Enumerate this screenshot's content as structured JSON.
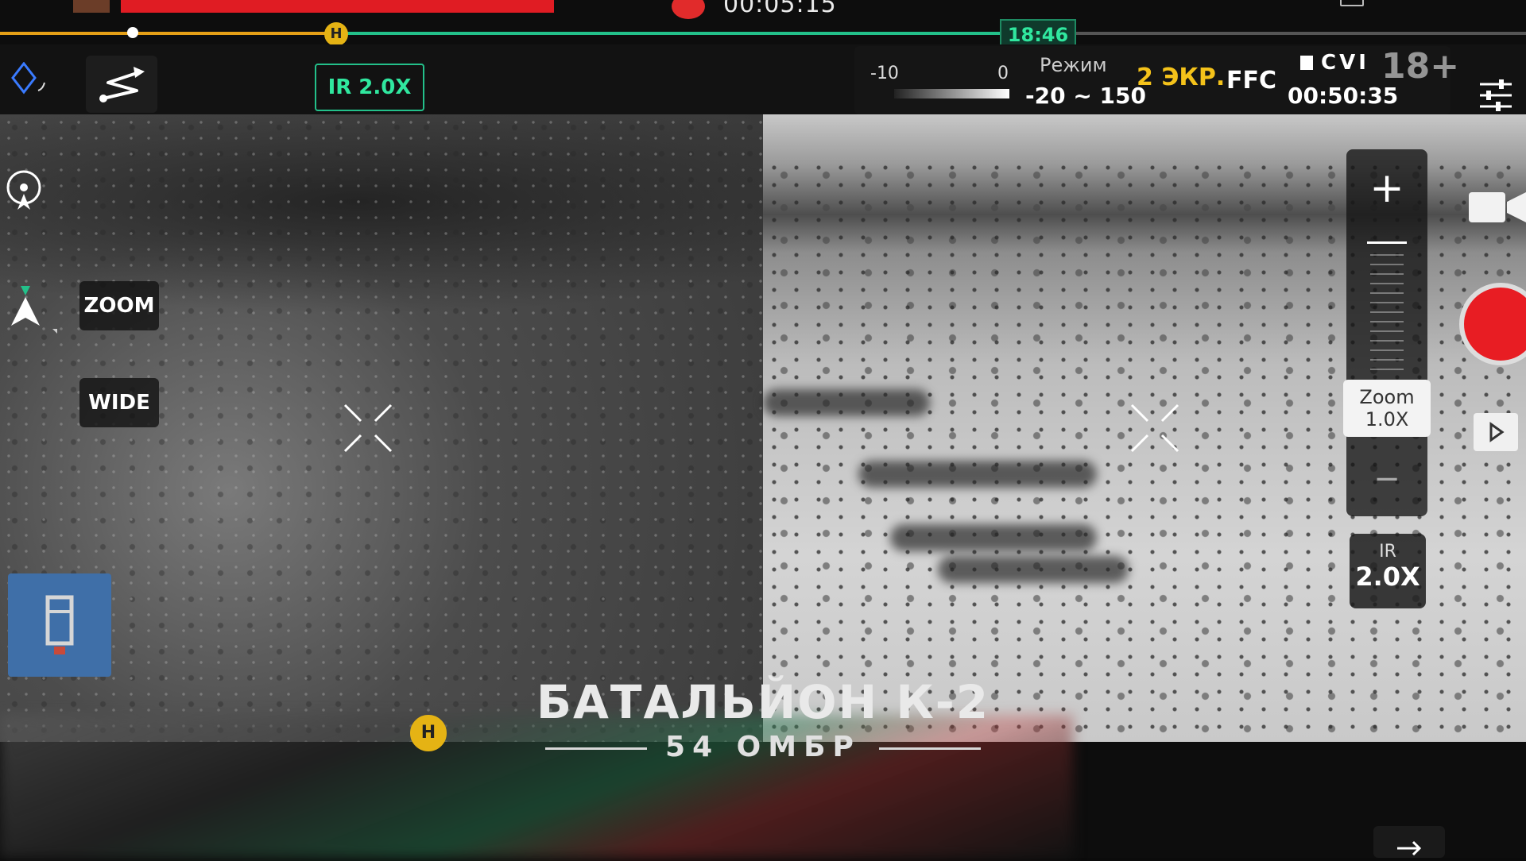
{
  "topbar": {
    "recording_time": "00:05:15",
    "current_time": "18:46",
    "home_marker": "H",
    "playback_progress": 0.087
  },
  "toolbar": {
    "ir_zoom_badge": "IR  2.0X"
  },
  "status": {
    "scale_min": "-10",
    "scale_zero": "0",
    "mode_label": "Режим",
    "range_label": "-20 ~ 150",
    "screen_label": "2 ЭКР.",
    "ffc_label": "FFC",
    "cvi_label": "CVI",
    "flight_time": "00:50:35",
    "age_badge": "18+"
  },
  "left_controls": {
    "zoom_label": "ZOOM",
    "wide_label": "WIDE"
  },
  "zoom_panel": {
    "plus": "+",
    "minus": "−",
    "readout_label": "Zoom",
    "readout_value": "1.0X",
    "ir_label": "IR",
    "ir_value": "2.0X"
  },
  "watermark": {
    "title": "БАТАЛЬЙОН К-2",
    "subtitle": "54 ОМБР"
  },
  "bottom": {
    "home_marker": "H"
  },
  "colors": {
    "accent_green": "#30e79f",
    "record_red": "#e81d23",
    "home_yellow": "#e5b314",
    "screen_label_yellow": "#f4c21a"
  },
  "icons": [
    "diamond-icon",
    "route-icon",
    "compass-icon",
    "aircraft-icon",
    "map-thumbnail",
    "camera-icon",
    "record-icon",
    "play-icon",
    "settings-sliders-icon",
    "sd-card-icon",
    "crosshair-icon"
  ]
}
